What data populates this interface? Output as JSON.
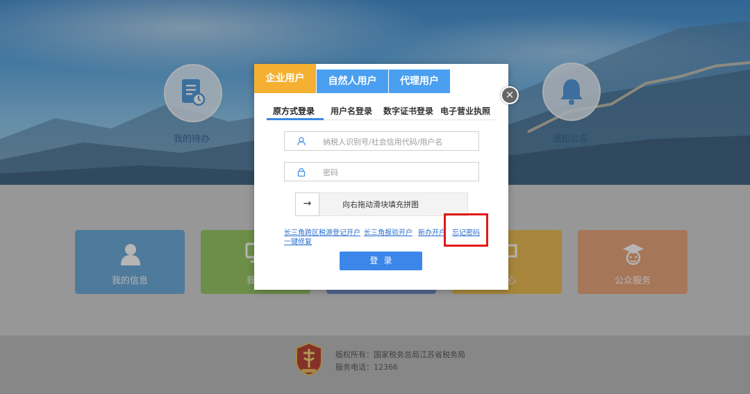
{
  "hero": {
    "items": [
      {
        "label": "我的待办",
        "icon": "document-clock-icon"
      },
      {
        "label": "通知公告",
        "icon": "bell-icon"
      }
    ]
  },
  "cards": [
    {
      "label": "我的信息",
      "icon": "user-icon",
      "color": "#5aa1d6"
    },
    {
      "label": "我要",
      "icon": "monitor-icon",
      "color": "#8cc152"
    },
    {
      "label": "",
      "icon": "",
      "color": "#5e7fc4"
    },
    {
      "label": "中心",
      "icon": "chat-icon",
      "color": "#e9b43d"
    },
    {
      "label": "公众服务",
      "icon": "graduate-icon",
      "color": "#e79a6a"
    }
  ],
  "footer": {
    "copyright": "版权所有：国家税务总局江苏省税务局",
    "phone": "服务电话：12366"
  },
  "dialog": {
    "user_tabs": [
      {
        "label": "企业用户",
        "active": true
      },
      {
        "label": "自然人用户",
        "active": false
      },
      {
        "label": "代理用户",
        "active": false
      }
    ],
    "close_label": "×",
    "login_tabs": [
      {
        "label": "原方式登录",
        "active": true
      },
      {
        "label": "用户名登录",
        "active": false
      },
      {
        "label": "数字证书登录",
        "active": false
      },
      {
        "label": "电子营业执照",
        "active": false
      }
    ],
    "username_placeholder": "纳税人识别号/社会信用代码/用户名",
    "password_placeholder": "密码",
    "slider_text": "向右拖动滑块填充拼图",
    "slider_arrow": "→",
    "links": [
      {
        "label": "长三角跨区税源登记开户"
      },
      {
        "label": "长三角报验开户"
      },
      {
        "label": "新办开户"
      },
      {
        "label": "忘记密码"
      },
      {
        "label": "一键修复"
      }
    ],
    "login_button": "登录"
  },
  "colors": {
    "accent_blue": "#3c86ea",
    "active_tab_orange": "#f5b031",
    "inactive_tab_blue": "#4a9ff0",
    "highlight_red": "#e01919"
  }
}
